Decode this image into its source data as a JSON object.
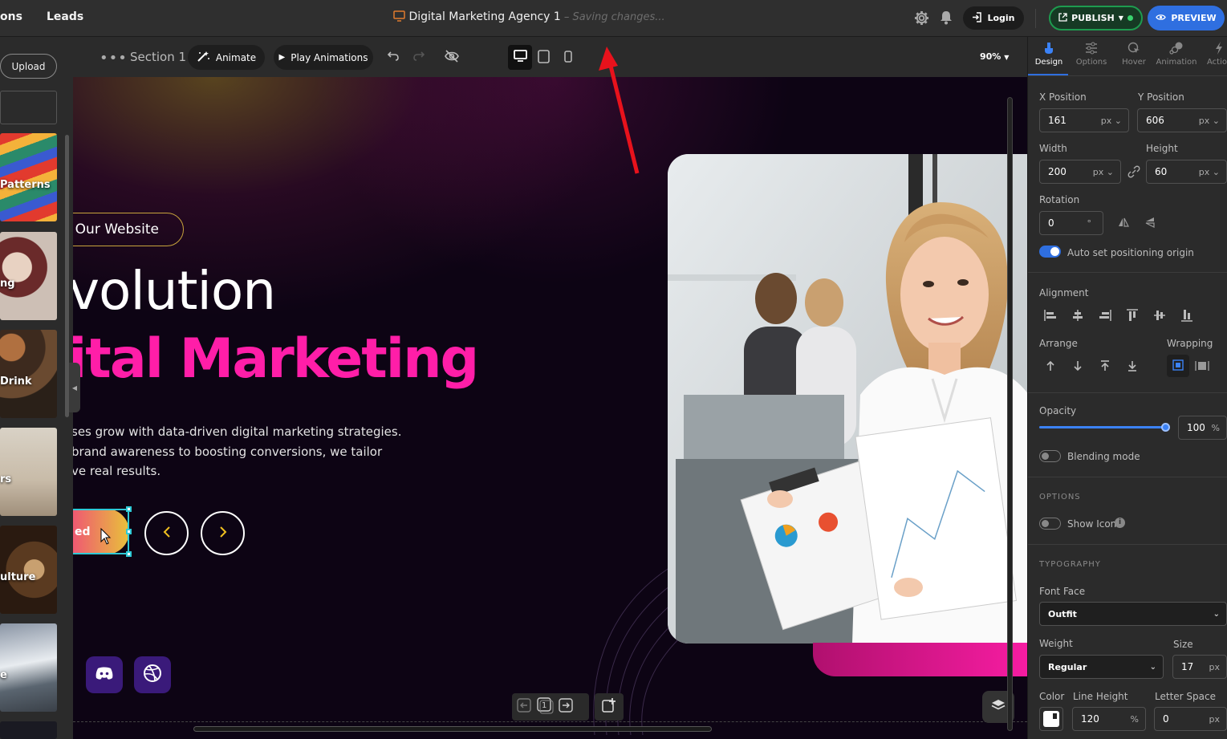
{
  "topbar": {
    "nav_left_partial": "ons",
    "nav_leads": "Leads",
    "project_title": "Digital Marketing Agency 1",
    "saving_status": "– Saving changes...",
    "login_label": "Login",
    "publish_label": "PUBLISH",
    "preview_label": "PREVIEW"
  },
  "left_panel": {
    "upload_label": "Upload",
    "thumbnails": [
      {
        "label": "Patterns"
      },
      {
        "label": "ng"
      },
      {
        "label": "Drink"
      },
      {
        "label": "rs"
      },
      {
        "label": "ulture"
      },
      {
        "label": "e"
      }
    ]
  },
  "toolbar": {
    "section_label": "Section 1",
    "animate_label": "Animate",
    "play_label": "Play Animations",
    "zoom_label": "90%"
  },
  "canvas": {
    "welcome_text": "o Our Website",
    "heading_white": "volution",
    "heading_pink": "ital Marketing",
    "paragraph": [
      "ses grow with data-driven digital marketing strategies.",
      "brand awareness to boosting conversions, we tailor",
      "ve real results."
    ],
    "cta_label": "ed"
  },
  "right_panel": {
    "tabs": [
      "Design",
      "Options",
      "Hover",
      "Animation",
      "Actio"
    ],
    "x_position_label": "X Position",
    "x_position_value": "161",
    "y_position_label": "Y Position",
    "y_position_value": "606",
    "width_label": "Width",
    "width_value": "200",
    "height_label": "Height",
    "height_value": "60",
    "unit_px": "px",
    "rotation_label": "Rotation",
    "rotation_value": "0",
    "rotation_unit": "°",
    "auto_origin_label": "Auto set positioning origin",
    "alignment_label": "Alignment",
    "arrange_label": "Arrange",
    "wrapping_label": "Wrapping",
    "opacity_label": "Opacity",
    "opacity_value": "100",
    "opacity_unit": "%",
    "opacity_level": 1.0,
    "blending_label": "Blending mode",
    "options_section": "OPTIONS",
    "show_icon_label": "Show Icon",
    "typography_section": "TYPOGRAPHY",
    "font_face_label": "Font Face",
    "font_face_value": "Outfit",
    "weight_label": "Weight",
    "weight_value": "Regular",
    "size_label": "Size",
    "size_value": "17",
    "color_label": "Color",
    "line_height_label": "Line Height",
    "line_height_value": "120",
    "line_height_unit": "%",
    "letter_space_label": "Letter Space",
    "letter_space_value": "0"
  },
  "colors": {
    "accent_blue": "#2f6fe0",
    "publish_green": "#1e9b4f",
    "heading_pink": "#ff1ea8",
    "selection_cyan": "#2ec9d6",
    "annotation_red": "#e8121c"
  }
}
